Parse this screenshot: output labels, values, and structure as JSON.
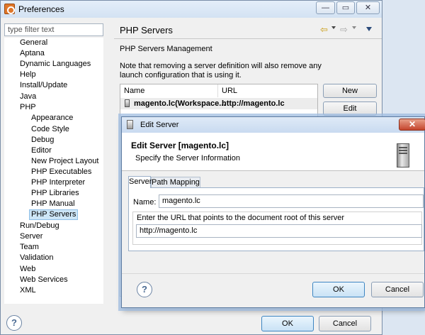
{
  "preferences": {
    "title": "Preferences",
    "window_controls": [
      "—",
      "▭",
      "✕"
    ],
    "filter_placeholder": "type filter text",
    "tree_top": [
      "General",
      "Aptana",
      "Dynamic Languages",
      "Help",
      "Install/Update",
      "Java",
      "PHP"
    ],
    "tree_php": [
      "Appearance",
      "Code Style",
      "Debug",
      "Editor",
      "New Project Layout",
      "PHP Executables",
      "PHP Interpreter",
      "PHP Libraries",
      "PHP Manual",
      "PHP Servers"
    ],
    "tree_bottom": [
      "Run/Debug",
      "Server",
      "Team",
      "Validation",
      "Web",
      "Web Services",
      "XML"
    ],
    "selected_item": "PHP Servers",
    "pane_title": "PHP Servers",
    "section_heading": "PHP Servers Management",
    "note": "Note that removing a server definition will also remove any launch configuration that is using it.",
    "table": {
      "columns": [
        "Name",
        "URL"
      ],
      "rows": [
        {
          "name": "magento.lc(Workspace...",
          "url": "http://magento.lc"
        }
      ]
    },
    "buttons": {
      "new": "New",
      "edit": "Edit",
      "ok": "OK",
      "cancel": "Cancel"
    },
    "help_glyph": "?"
  },
  "edit_server": {
    "title": "Edit Server",
    "heading": "Edit Server [magento.lc]",
    "subtitle": "Specify the Server Information",
    "close_glyph": "✕",
    "tabs": [
      "Server",
      "Path Mapping"
    ],
    "name_label": "Name:",
    "name_value": "magento.lc",
    "url_group_label": "Enter the URL that points to the document root of this server",
    "url_value": "http://magento.lc",
    "buttons": {
      "ok": "OK",
      "cancel": "Cancel"
    },
    "help_glyph": "?"
  },
  "icons": {
    "app": "preferences-icon",
    "server": "server-icon",
    "help": "help-icon",
    "back": "back-arrow-icon",
    "forward": "forward-arrow-icon"
  }
}
